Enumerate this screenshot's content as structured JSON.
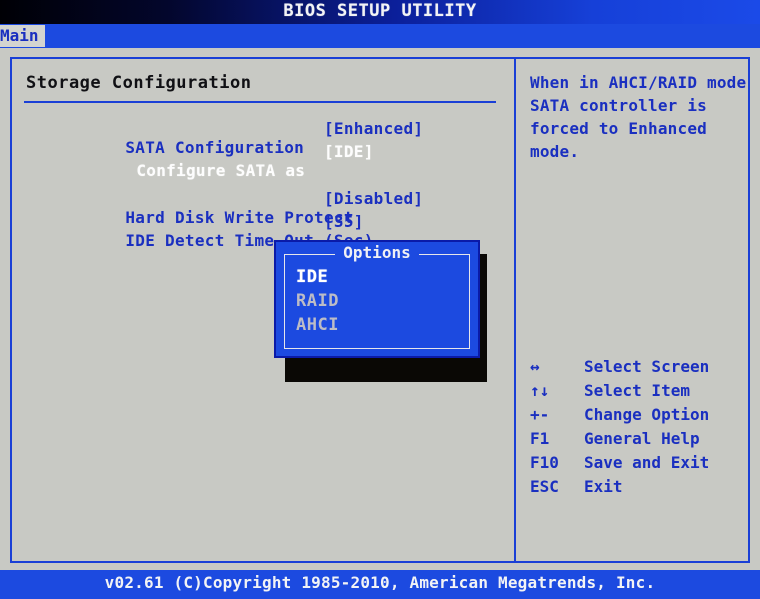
{
  "header": {
    "title": "BIOS SETUP UTILITY"
  },
  "menubar": {
    "tabs": [
      {
        "label": "Main",
        "active": true
      }
    ]
  },
  "main": {
    "section_title": "Storage Configuration",
    "rows": [
      {
        "label": "SATA Configuration",
        "value": "[Enhanced]",
        "selected": false,
        "indent": false
      },
      {
        "label": "Configure SATA as",
        "value": "[IDE]",
        "selected": true,
        "indent": true
      },
      {
        "label": "Hard Disk Write Protect",
        "value": "[Disabled]",
        "selected": false,
        "indent": false
      },
      {
        "label": "IDE Detect Time Out (Sec)",
        "value": "[35]",
        "selected": false,
        "indent": false
      }
    ]
  },
  "popup": {
    "title": "Options",
    "options": [
      {
        "label": "IDE",
        "active": true
      },
      {
        "label": "RAID",
        "active": false
      },
      {
        "label": "AHCI",
        "active": false
      }
    ]
  },
  "help": {
    "lines": [
      "When in AHCI/RAID mode",
      "SATA controller is",
      "forced to Enhanced",
      "mode."
    ]
  },
  "legend": [
    {
      "key": "↔",
      "desc": "Select Screen",
      "icon": "left-right-arrow-icon"
    },
    {
      "key": "↑↓",
      "desc": "Select Item",
      "icon": "up-down-arrow-icon"
    },
    {
      "key": "+-",
      "desc": "Change Option",
      "icon": "plus-minus-icon"
    },
    {
      "key": "F1",
      "desc": "General Help",
      "icon": "f1-key-icon"
    },
    {
      "key": "F10",
      "desc": "Save and Exit",
      "icon": "f10-key-icon"
    },
    {
      "key": "ESC",
      "desc": "Exit",
      "icon": "esc-key-icon"
    }
  ],
  "footer": {
    "copyright": "v02.61 (C)Copyright 1985-2010, American Megatrends, Inc."
  },
  "colors": {
    "background": "#c8c9c4",
    "accent_blue": "#1c4ae0",
    "text_blue": "#1a2fc0",
    "text_white": "#ffffff",
    "title_black": "#101014"
  }
}
